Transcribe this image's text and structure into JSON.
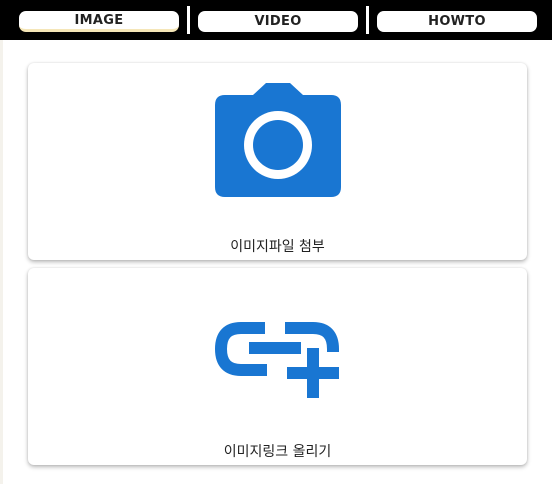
{
  "tabs": [
    {
      "label": "IMAGE",
      "active": true
    },
    {
      "label": "VIDEO",
      "active": false
    },
    {
      "label": "HOWTO",
      "active": false
    }
  ],
  "cards": [
    {
      "label": "이미지파일 첨부",
      "icon": "camera-icon"
    },
    {
      "label": "이미지링크 올리기",
      "icon": "add-link-icon"
    }
  ],
  "colors": {
    "tabbar": "#000000",
    "icon": "#1976d2",
    "active_tab_underline": "#f5e6b8"
  }
}
